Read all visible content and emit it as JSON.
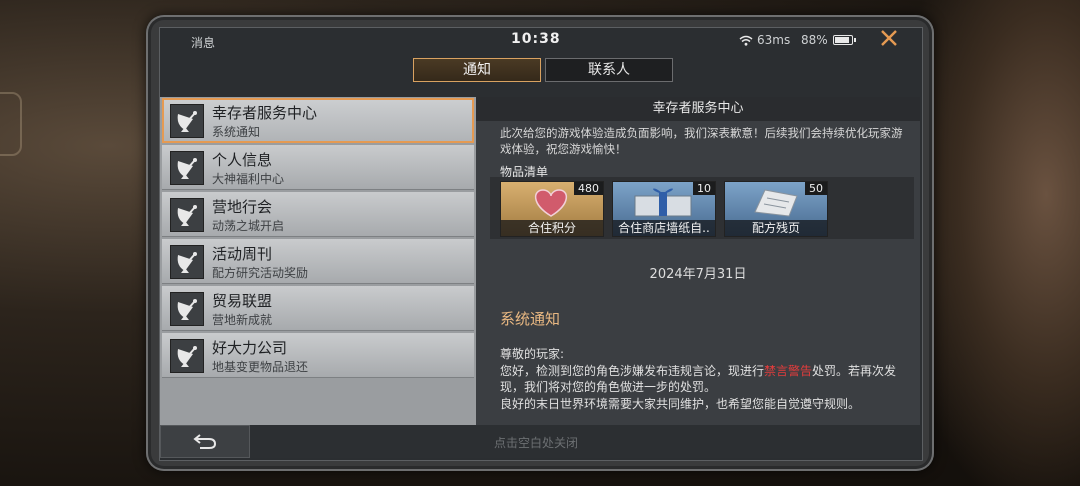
{
  "header": {
    "title": "消息",
    "time": "10:38",
    "network": "63ms",
    "battery": "88%",
    "battery_level": 0.88
  },
  "tabs": [
    {
      "label": "通知",
      "active": true
    },
    {
      "label": "联系人",
      "active": false
    }
  ],
  "sidebar": {
    "items": [
      {
        "name": "幸存者服务中心",
        "sub": "系统通知",
        "selected": true
      },
      {
        "name": "个人信息",
        "sub": "大神福利中心"
      },
      {
        "name": "营地行会",
        "sub": "动荡之城开启"
      },
      {
        "name": "活动周刊",
        "sub": "配方研究活动奖励"
      },
      {
        "name": "贸易联盟",
        "sub": "营地新成就"
      },
      {
        "name": "好大力公司",
        "sub": "地基变更物品退还"
      }
    ],
    "icon": "satellite-dish-icon"
  },
  "content": {
    "title": "幸存者服务中心",
    "intro": "此次给您的游戏体验造成负面影响，我们深表歉意！后续我们会持续优化玩家游戏体验，祝您游戏愉快！",
    "items_label": "物品清单",
    "rewards": [
      {
        "label": "合住积分",
        "count": "480"
      },
      {
        "label": "合住商店墙纸自..",
        "count": "10"
      },
      {
        "label": "配方残页",
        "count": "50"
      }
    ],
    "date": "2024年7月31日",
    "section_title": "系统通知",
    "greeting": "尊敬的玩家:",
    "line1_a": " 您好，检测到您的角色涉嫌发布违规言论，现进行",
    "line1_red": "禁言警告",
    "line1_b": "处罚。若再次发现，我们将对您的角色做进一步的处罚。",
    "line2": "良好的末日世界环境需要大家共同维护，也希望您能自觉遵守规则。"
  },
  "footer": {
    "hint": "点击空白处关闭"
  },
  "colors": {
    "accent": "#e59a52",
    "warning": "#e33c3c"
  }
}
